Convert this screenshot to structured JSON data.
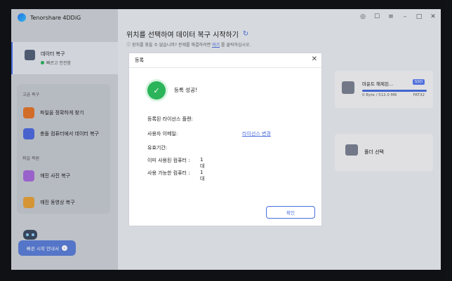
{
  "app": {
    "title": "Tenorshare 4DDiG"
  },
  "sidebar": {
    "active_item": {
      "label": "데이터 복구",
      "status": "빠르고 안전함"
    },
    "section_advanced": "고급 복구",
    "items_advanced": [
      {
        "label": "파일을 정확하게 찾기"
      },
      {
        "label": "충돌 컴퓨터에서 데이터 복구"
      }
    ],
    "section_repair": "파일 복원",
    "items_repair": [
      {
        "label": "깨진 사진 복구"
      },
      {
        "label": "깨진 동영상 복구"
      }
    ],
    "quick_start_label": "빠른 시작 안내서"
  },
  "main": {
    "title": "위치를 선택하여 데이터 복구 시작하기",
    "subtitle_prefix": "장치를 찾을 수 없습니까? 문제를 해결하려면",
    "subtitle_link": "여기",
    "subtitle_suffix": "를 클릭하십시오."
  },
  "drive": {
    "name": "마운트 해제된...",
    "badge": "SSD",
    "size": "0 Byte / 512.0 MB",
    "fs": "FAT32",
    "usage_fraction": 1.0
  },
  "folder": {
    "label": "폴더 선택"
  },
  "dialog": {
    "title": "등록",
    "success": "등록 성공!",
    "license_plan_label": "등록된 라이선스 플랜:",
    "email_label": "사용자 이메일:",
    "change_license_link": "라이선스 변경",
    "expiry_label": "유효기간:",
    "used_label": "이미 사용된 컴퓨터 :",
    "used_value": "1대",
    "available_label": "사용 가능한 컴퓨터 :",
    "available_value": "1대",
    "confirm_label": "확인"
  },
  "colors": {
    "accent": "#4a6ee0",
    "success": "#2bb45a"
  }
}
